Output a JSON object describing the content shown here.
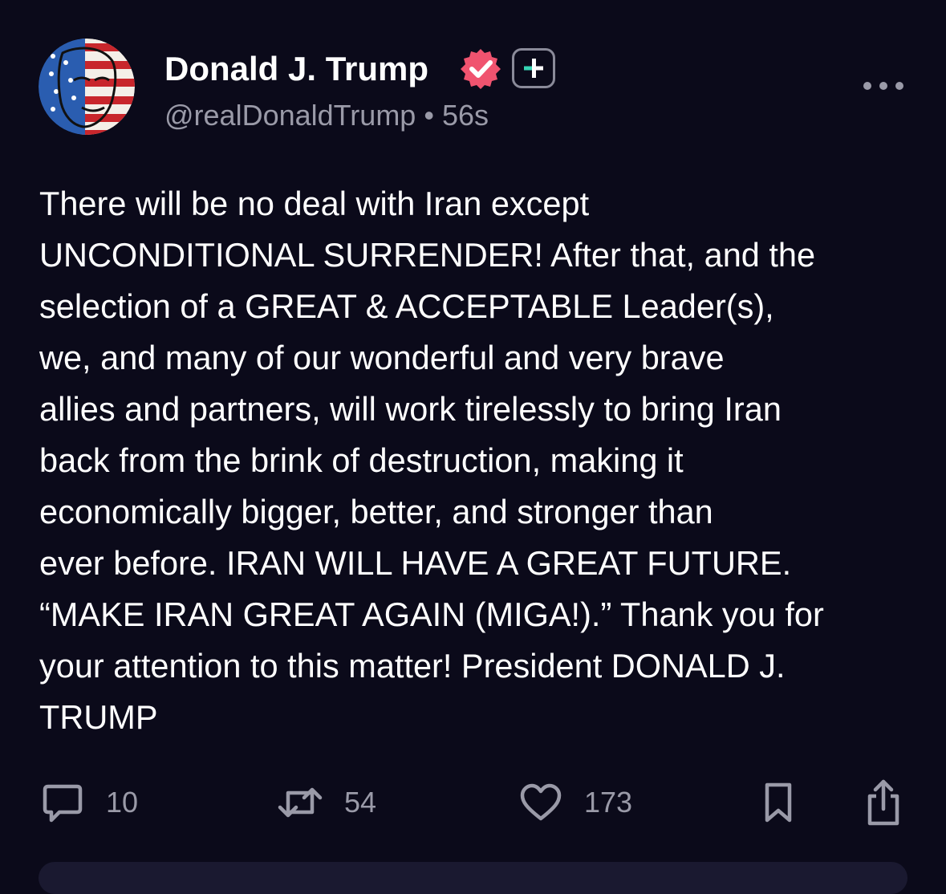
{
  "post": {
    "author_name": "Donald J. Trump",
    "handle": "@realDonaldTrump",
    "separator": "•",
    "time": "56s",
    "body": "There will be no deal with Iran except\nUNCONDITIONAL SURRENDER! After that, and the\nselection of a GREAT & ACCEPTABLE Leader(s),\nwe, and many of our wonderful and very brave\nallies and partners, will work tirelessly to bring Iran\nback from the brink of destruction, making it\neconomically bigger, better, and stronger than\never before. IRAN WILL HAVE A GREAT FUTURE.\n“MAKE IRAN GREAT AGAIN (MIGA!).” Thank you for\nyour attention to this matter! President DONALD J.\nTRUMP"
  },
  "actions": {
    "replies": "10",
    "reposts": "54",
    "likes": "173"
  },
  "icons": {
    "verified": "verified-badge-icon",
    "plus": "plus-badge-icon",
    "more": "more-options-icon",
    "reply": "reply-icon",
    "repost": "repost-icon",
    "like": "heart-icon",
    "bookmark": "bookmark-icon",
    "share": "share-icon"
  },
  "colors": {
    "background": "#0b0a1a",
    "text": "#ffffff",
    "muted": "#9a9aa8",
    "verified": "#f0536f",
    "plus_accent": "#36d4b4"
  }
}
